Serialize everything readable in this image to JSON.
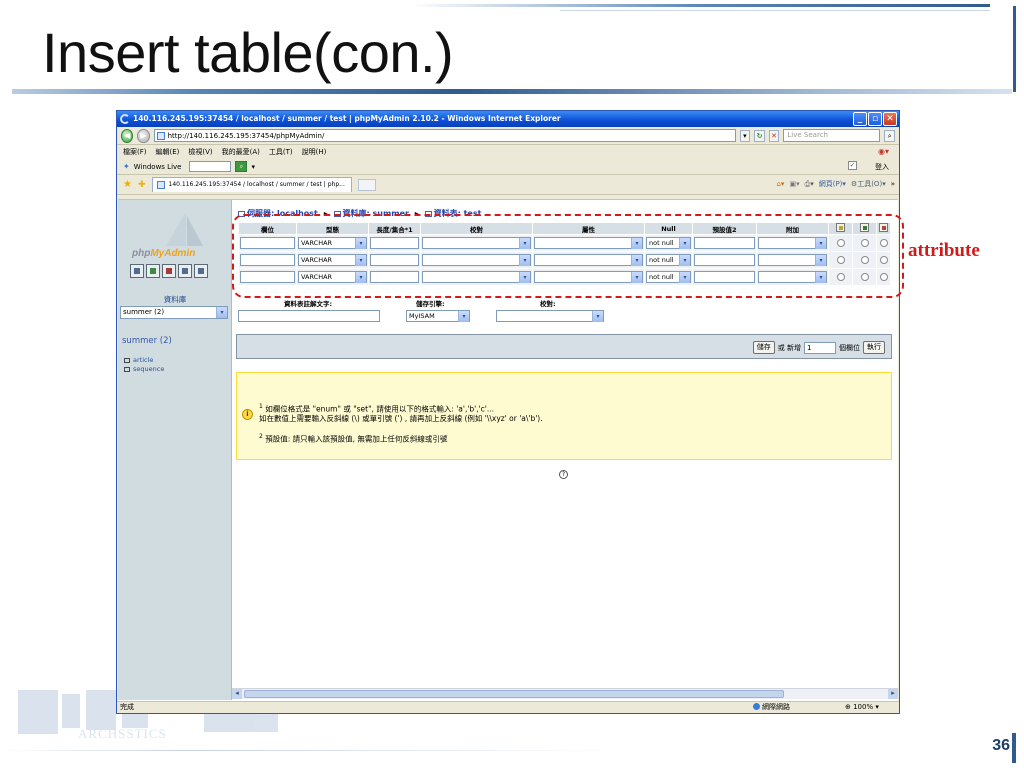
{
  "slide": {
    "title": "Insert table(con.)",
    "number": "36",
    "annotation_label": "attribute",
    "watermark_text": "ARCHSSTICS"
  },
  "window": {
    "title": "140.116.245.195:37454 / localhost / summer / test | phpMyAdmin 2.10.2 - Windows Internet Explorer",
    "address": "http://140.116.245.195:37454/phpMyAdmin/",
    "search_placeholder": "Live Search",
    "menu": [
      "檔案(F)",
      "編輯(E)",
      "檢視(V)",
      "我的最愛(A)",
      "工具(T)",
      "說明(H)"
    ],
    "live_label": "Windows Live",
    "sign_in": "登入",
    "tab_title": "140.116.245.195:37454 / localhost / summer / test | php...",
    "cmd_page": "網頁(P)",
    "cmd_tools": "工具(O)",
    "status_text": "完成",
    "zone": "網際網路",
    "zoom": "100%"
  },
  "sidebar": {
    "db_label": "資料庫",
    "db_select": "summer (2)",
    "db_name": "summer (2)",
    "tables": [
      "article",
      "sequence"
    ]
  },
  "breadcrumb": {
    "server": "伺服器: localhost",
    "database": "資料庫: summer",
    "table": "資料表: test"
  },
  "grid": {
    "headers": [
      "欄位",
      "型態",
      "長度/集合*1",
      "校對",
      "屬性",
      "Null",
      "預設值2",
      "附加"
    ],
    "rows": [
      {
        "type": "VARCHAR",
        "null": "not null"
      },
      {
        "type": "VARCHAR",
        "null": "not null"
      },
      {
        "type": "VARCHAR",
        "null": "not null"
      }
    ]
  },
  "props": {
    "comment_label": "資料表註解文字:",
    "engine_label": "儲存引擎:",
    "engine_value": "MyISAM",
    "collation_label": "校對:"
  },
  "actions": {
    "save": "儲存",
    "or_add": "或 新增",
    "add_count": "1",
    "fields_label": "個欄位",
    "go": "執行"
  },
  "notice": {
    "line1": "如欄位格式是 \"enum\" 或 \"set\", 請使用以下的格式輸入: 'a','b','c'...",
    "line2": "如在數值上需要輸入反斜線 (\\) 或單引號 (') , 請再加上反斜線 (例如 '\\\\xyz' or 'a\\'b').",
    "line3": "預設值: 請只輸入該預設值, 無需加上任何反斜線或引號"
  }
}
